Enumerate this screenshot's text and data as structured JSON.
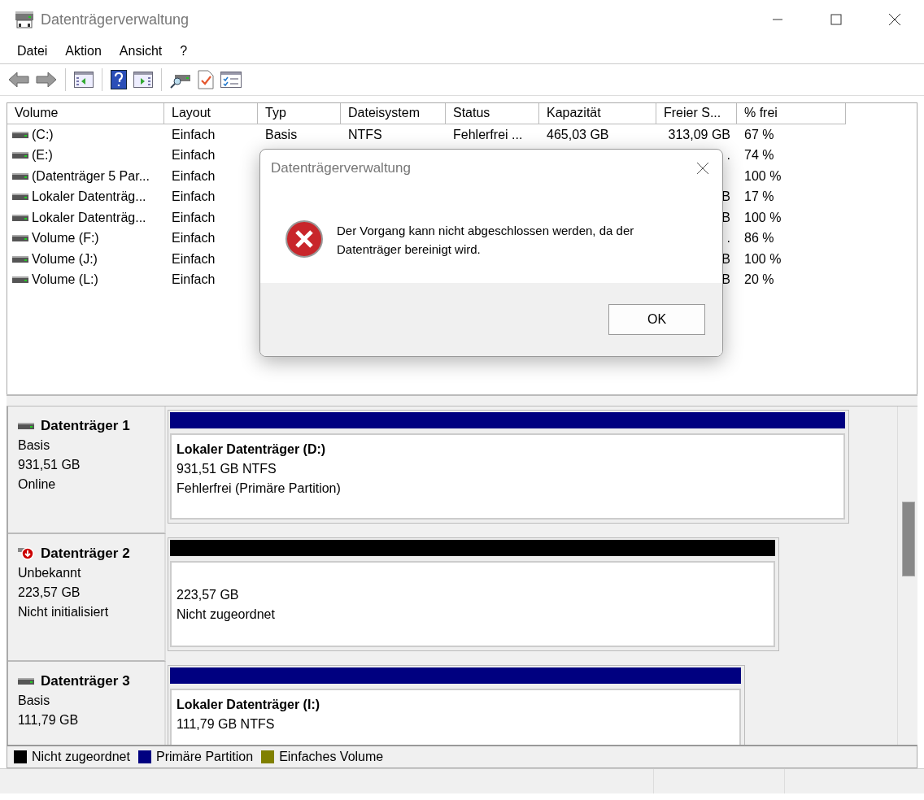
{
  "window": {
    "title": "Datenträgerverwaltung"
  },
  "menu": [
    "Datei",
    "Aktion",
    "Ansicht",
    "?"
  ],
  "toolbar": [
    {
      "kind": "back"
    },
    {
      "kind": "forward"
    },
    {
      "kind": "sep"
    },
    {
      "kind": "panel-left"
    },
    {
      "kind": "sep"
    },
    {
      "kind": "help"
    },
    {
      "kind": "panel-right"
    },
    {
      "kind": "sep"
    },
    {
      "kind": "drive-search"
    },
    {
      "kind": "check-doc"
    },
    {
      "kind": "checklist"
    }
  ],
  "table": {
    "columns": [
      "Volume",
      "Layout",
      "Typ",
      "Dateisystem",
      "Status",
      "Kapazität",
      "Freier S...",
      "% frei"
    ],
    "rows": [
      {
        "volume": " (C:)",
        "layout": "Einfach",
        "typ": "Basis",
        "dateisystem": "NTFS",
        "status": "Fehlerfrei ...",
        "kapazitaet": "465,03 GB",
        "freier": "313,09 GB",
        "frei": "67 %"
      },
      {
        "volume": " (E:)",
        "layout": "Einfach",
        "freier": ".",
        "frei": "74 %"
      },
      {
        "volume": "(Datenträger 5 Par...",
        "layout": "Einfach",
        "frei": "100 %"
      },
      {
        "volume": "Lokaler Datenträg...",
        "layout": "Einfach",
        "freier": "B",
        "frei": "17 %"
      },
      {
        "volume": "Lokaler Datenträg...",
        "layout": "Einfach",
        "freier": "B",
        "frei": "100 %"
      },
      {
        "volume": "Volume (F:)",
        "layout": "Einfach",
        "freier": ".",
        "frei": "86 %"
      },
      {
        "volume": "Volume (J:)",
        "layout": "Einfach",
        "freier": "B",
        "frei": "100 %"
      },
      {
        "volume": "Volume (L:)",
        "layout": "Einfach",
        "freier": "B",
        "frei": "20 %"
      }
    ]
  },
  "disks": [
    {
      "kind": "normal",
      "name": "Datenträger 1",
      "lines": [
        "Basis",
        "931,51 GB",
        "Online"
      ],
      "partition": {
        "kind": "primary",
        "title": "Lokaler Datenträger  (D:)",
        "lines": [
          "931,51 GB NTFS",
          "Fehlerfrei (Primäre Partition)"
        ]
      }
    },
    {
      "kind": "error",
      "name": "Datenträger 2",
      "lines": [
        "Unbekannt",
        "223,57 GB",
        "Nicht initialisiert"
      ],
      "partition": {
        "kind": "unallocated",
        "lines": [
          "223,57 GB",
          "Nicht zugeordnet"
        ]
      }
    },
    {
      "kind": "normal",
      "name": "Datenträger 3",
      "lines": [
        "Basis",
        "111,79 GB"
      ],
      "partition": {
        "kind": "primary",
        "title": "Lokaler Datenträger  (I:)",
        "lines": [
          "111,79 GB NTFS"
        ]
      }
    }
  ],
  "legend": [
    {
      "label": "Nicht zugeordnet",
      "color": "#000000"
    },
    {
      "label": "Primäre Partition",
      "color": "#000080"
    },
    {
      "label": "Einfaches Volume",
      "color": "#808000"
    }
  ],
  "dialog": {
    "title": "Datenträgerverwaltung",
    "message": "Der Vorgang kann nicht abgeschlossen werden, da der Datenträger bereinigt wird.",
    "buttons": [
      "OK"
    ]
  }
}
